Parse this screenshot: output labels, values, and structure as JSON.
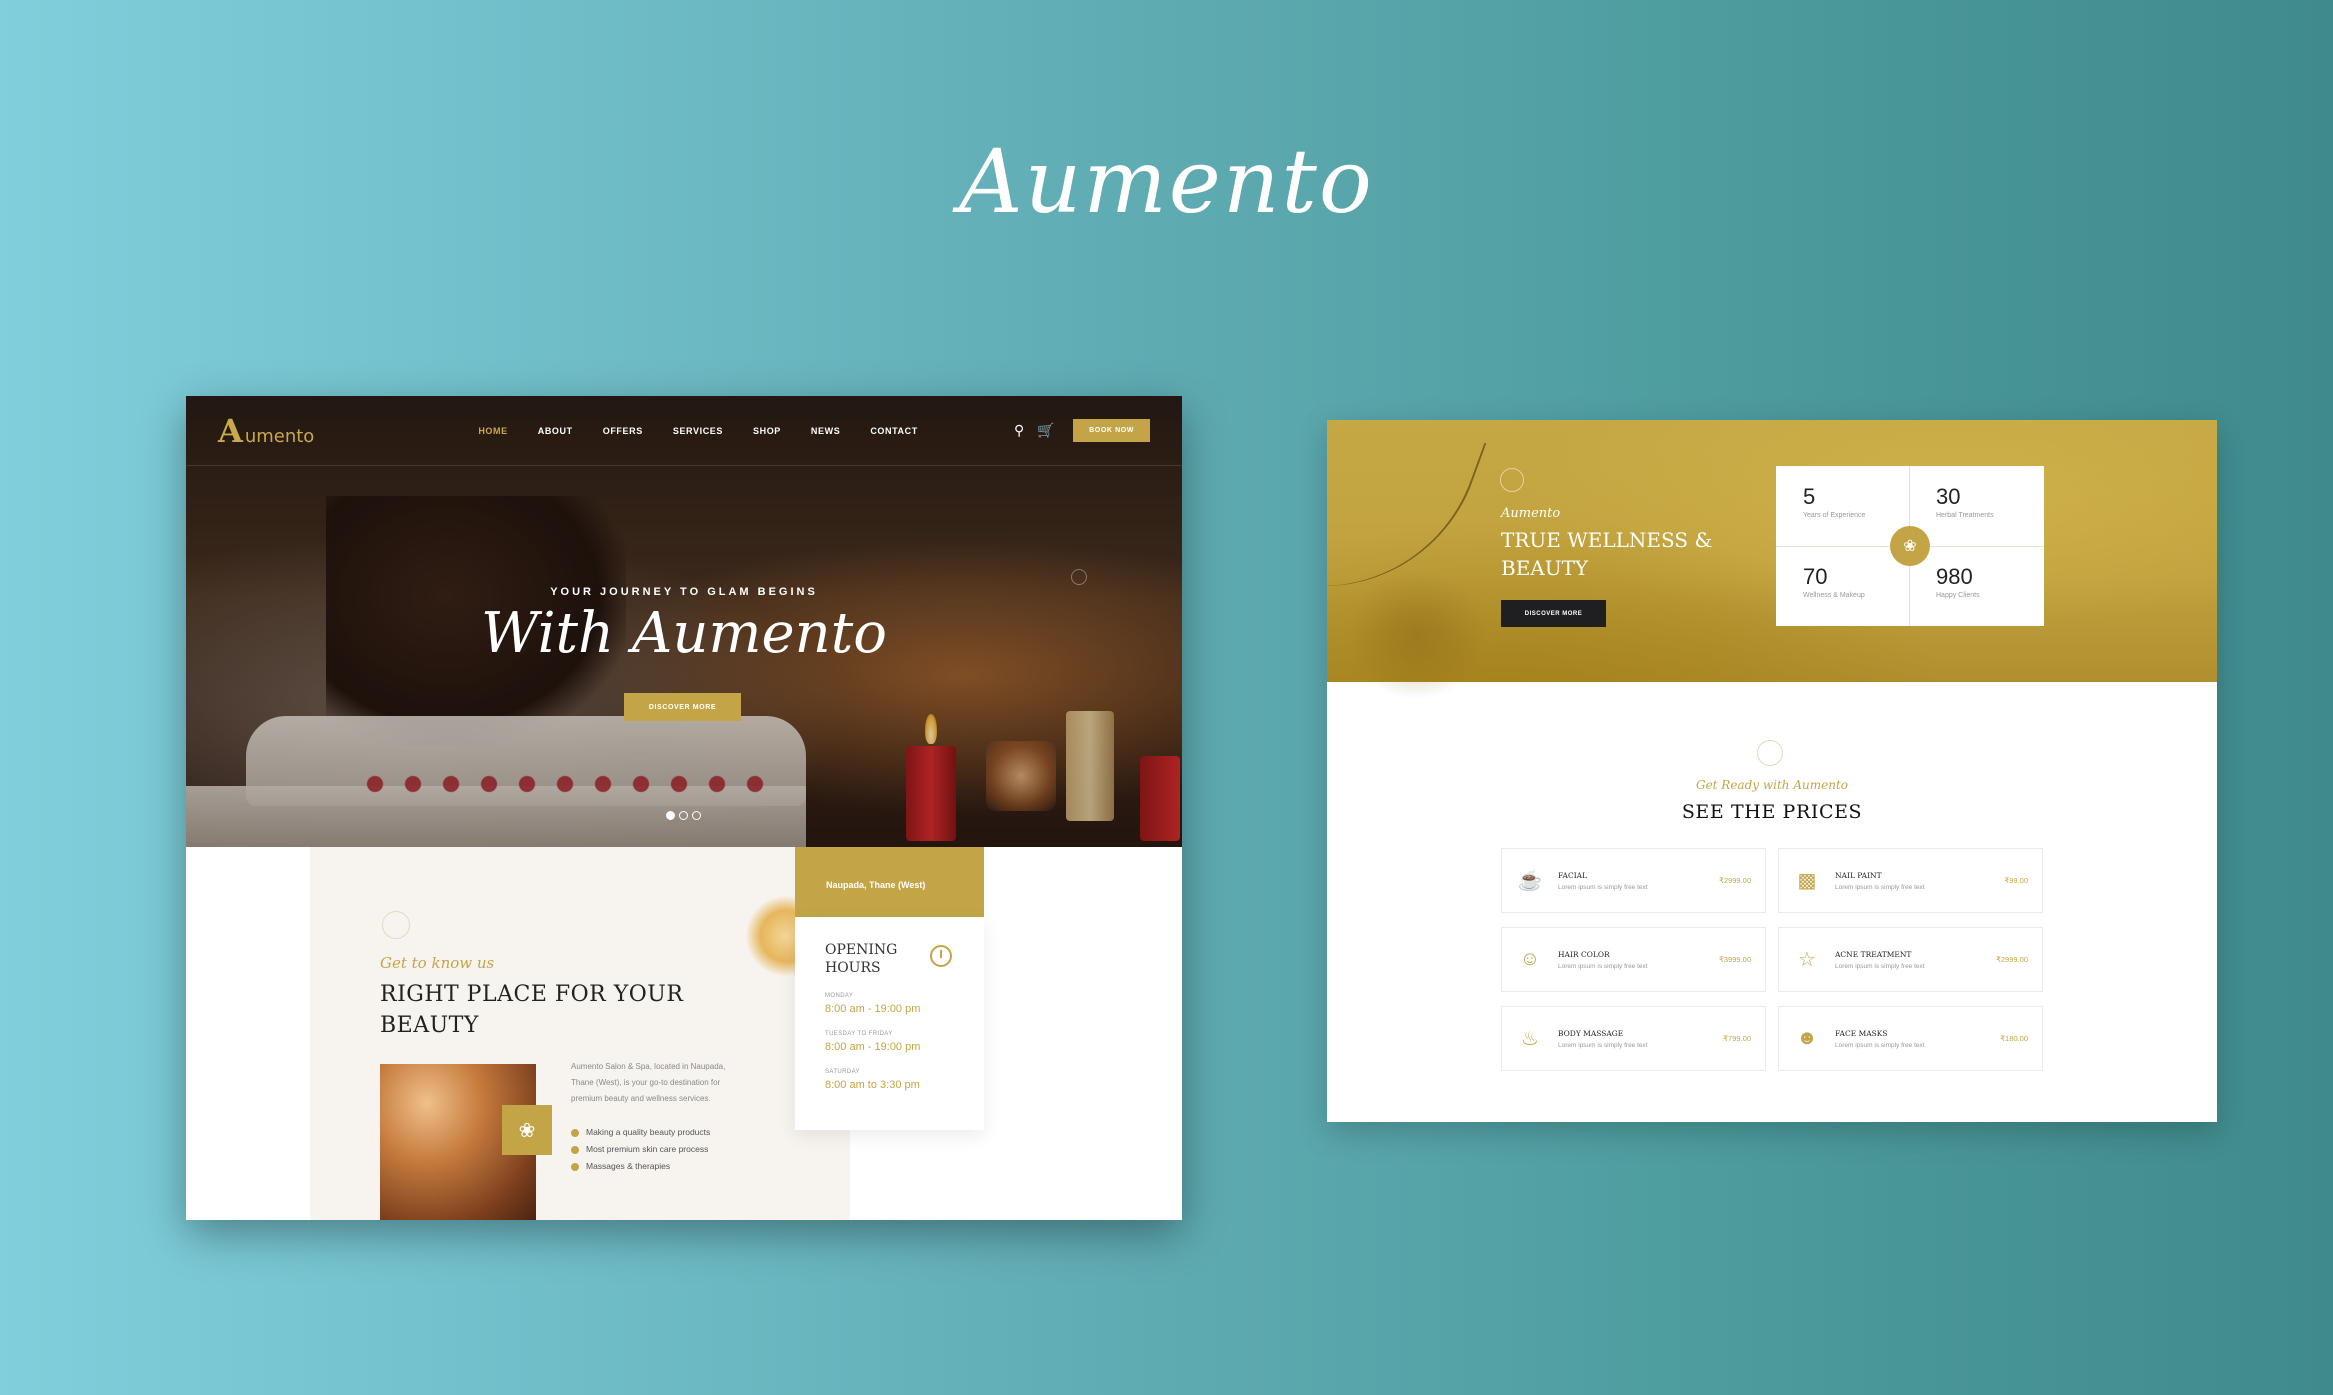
{
  "brand": {
    "title": "Aumento"
  },
  "left": {
    "nav": {
      "logo_text": "umento",
      "items": [
        "HOME",
        "ABOUT",
        "OFFERS",
        "SERVICES",
        "SHOP",
        "NEWS",
        "CONTACT"
      ],
      "book_label": "BOOK NOW",
      "icons": [
        "search-icon",
        "cart-icon"
      ]
    },
    "hero": {
      "kicker": "YOUR JOURNEY TO GLAM BEGINS",
      "title": "With Aumento",
      "button": "DISCOVER MORE",
      "slides": 3,
      "active_slide": 1
    },
    "about": {
      "kicker": "Get to know us",
      "title": "RIGHT PLACE FOR YOUR BEAUTY",
      "text": "Aumento Salon & Spa, located in Naupada, Thane (West), is your go-to destination for premium beauty and wellness services.",
      "list": [
        "Making a quality beauty products",
        "Most premium skin care process",
        "Massages & therapies"
      ]
    },
    "hours": {
      "location": "Naupada, Thane (West)",
      "title": "OPENING HOURS",
      "rows": [
        {
          "day": "MONDAY",
          "time": "8:00 am - 19:00 pm"
        },
        {
          "day": "TUESDAY TO FRIDAY",
          "time": "8:00 am - 19:00 pm"
        },
        {
          "day": "SATURDAY",
          "time": "8:00 am to 3:30 pm"
        }
      ]
    }
  },
  "right": {
    "band": {
      "kicker": "Aumento",
      "title": "TRUE WELLNESS & BEAUTY",
      "button": "DISCOVER MORE"
    },
    "stats": [
      {
        "num": "5",
        "label": "Years of Experience"
      },
      {
        "num": "30",
        "label": "Herbal Treatments"
      },
      {
        "num": "70",
        "label": "Wellness & Makeup"
      },
      {
        "num": "980",
        "label": "Happy Clients"
      }
    ],
    "prices": {
      "kicker": "Get Ready with Aumento",
      "title": "SEE THE PRICES",
      "items": [
        {
          "name": "FACIAL",
          "desc": "Lorem ipsum is simply free text",
          "price": "₹2999.00",
          "icon": "bowl-icon"
        },
        {
          "name": "NAIL PAINT",
          "desc": "Lorem ipsum is simply free text",
          "price": "₹99.00",
          "icon": "nail-polish-icon"
        },
        {
          "name": "HAIR COLOR",
          "desc": "Lorem ipsum is simply free text",
          "price": "₹3999.00",
          "icon": "hair-dye-icon"
        },
        {
          "name": "ACNE TREATMENT",
          "desc": "Lorem ipsum is simply free text",
          "price": "₹2999.00",
          "icon": "treatment-icon"
        },
        {
          "name": "BODY MASSAGE",
          "desc": "Lorem ipsum is simply free text",
          "price": "₹799.00",
          "icon": "massage-icon"
        },
        {
          "name": "FACE MASKS",
          "desc": "Lorem ipsum is simply free text",
          "price": "₹180.00",
          "icon": "face-mask-icon"
        }
      ]
    }
  },
  "colors": {
    "gold": "#c3a547",
    "dark": "#1f1e20",
    "background_teal": "#4f9ea0"
  }
}
